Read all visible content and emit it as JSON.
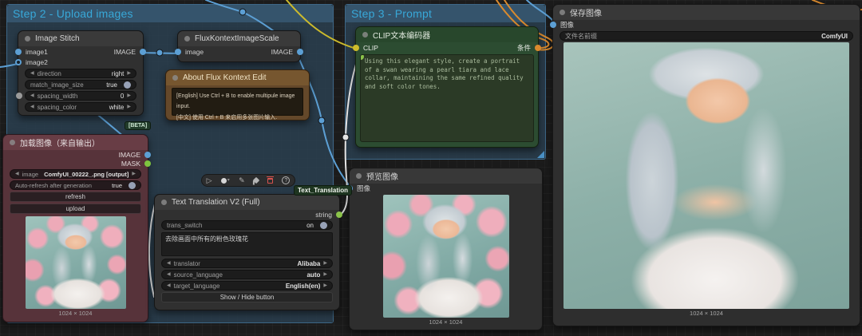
{
  "groups": {
    "step2": {
      "title": "Step 2 - Upload images"
    },
    "step3": {
      "title": "Step 3 - Prompt"
    }
  },
  "nodes": {
    "image_stitch": {
      "title": "Image Stitch",
      "input1": "image1",
      "input2": "image2",
      "output": "IMAGE",
      "widgets": [
        {
          "label": "direction",
          "value": "right"
        },
        {
          "label": "match_image_size",
          "value": "true"
        },
        {
          "label": "spacing_width",
          "value": "0"
        },
        {
          "label": "spacing_color",
          "value": "white"
        }
      ]
    },
    "flux_scale": {
      "title": "FluxKontextImageScale",
      "input": "image",
      "output": "IMAGE"
    },
    "about_note": {
      "title": "About Flux Kontext Edit",
      "line_en": "[English] Use Ctrl + B to enable multipule image input.",
      "line_zh": "[中文] 使用 Ctrl + B 来启用多张图片输入."
    },
    "load_image": {
      "title": "加载图像（来自输出）",
      "beta_badge": "[BETA]",
      "output_image": "IMAGE",
      "output_mask": "MASK",
      "image_widget": {
        "label": "image",
        "value": "ComfyUI_00222_.png [output]"
      },
      "autorefresh": {
        "label": "Auto-refresh after generation",
        "value": "true"
      },
      "refresh_button": "refresh",
      "upload_button": "upload",
      "size_caption": "1024 × 1024"
    },
    "text_translation": {
      "badge": "Text_Translation",
      "title": "Text Translation V2 (Full)",
      "output": "string",
      "trans_switch": {
        "label": "trans_switch",
        "value": "on"
      },
      "source_text": "去除画面中所有的粉色玫瑰花",
      "widgets": [
        {
          "label": "translator",
          "value": "Alibaba"
        },
        {
          "label": "source_language",
          "value": "auto"
        },
        {
          "label": "target_language",
          "value": "English(en)"
        }
      ],
      "toggle_button": "Show / Hide button"
    },
    "clip_encode": {
      "title": "CLIP文本编码器",
      "input": "CLIP",
      "output": "条件",
      "prompt": "Using this elegant style, create a portrait of a swan wearing a pearl tiara and lace collar, maintaining the same refined quality and soft color tones."
    },
    "preview_image": {
      "title": "预览图像",
      "input": "图像",
      "size_caption": "1024 × 1024"
    },
    "save_image": {
      "title": "保存图像",
      "input": "图像",
      "prefix_widget": {
        "label": "文件名前缀",
        "value": "ComfyUI"
      },
      "size_caption": "1024 × 1024"
    }
  },
  "colors": {
    "link_image": "#5c9fd4",
    "link_clip": "#cdbb2c",
    "link_conditioning": "#d98a2e",
    "link_string": "#e4e4e4",
    "port_mask": "#7ec43f",
    "group_title": "#38a8d8",
    "trash_red": "#d9534f"
  }
}
